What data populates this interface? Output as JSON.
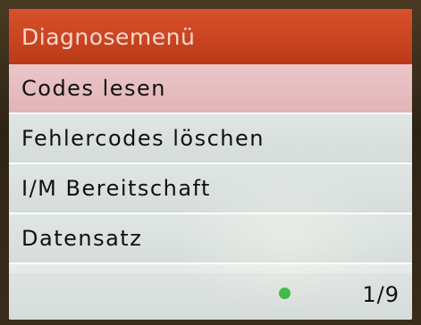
{
  "header": {
    "title": "Diagnosemenü",
    "color": "#c8431f"
  },
  "menu": {
    "selected_index": 0,
    "items": [
      {
        "label": "Codes lesen"
      },
      {
        "label": "Fehlercodes löschen"
      },
      {
        "label": "I/M Bereitschaft"
      },
      {
        "label": "Datensatz"
      }
    ]
  },
  "footer": {
    "status_icon": "green-dot",
    "status_color": "#2fb53a",
    "page": "1/9"
  }
}
